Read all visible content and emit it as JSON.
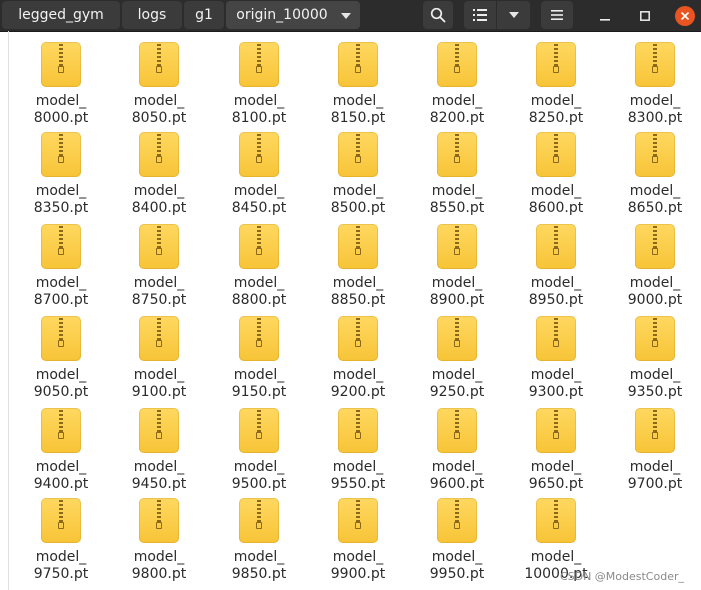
{
  "breadcrumbs": [
    {
      "label": "legged_gym"
    },
    {
      "label": "logs"
    },
    {
      "label": "g1"
    },
    {
      "label": "origin_10000"
    }
  ],
  "icons": {
    "search": "search-icon",
    "list_view": "list-view-icon",
    "view_options": "chevron-down-icon",
    "menu": "hamburger-menu-icon",
    "minimize": "minimize-icon",
    "maximize": "maximize-icon",
    "close": "close-icon",
    "file": "archive-file-icon"
  },
  "colors": {
    "header_bg": "#2c2c2c",
    "close_button": "#e95420",
    "archive_icon": "#f7c437"
  },
  "files": [
    "model_\n8000.pt",
    "model_\n8050.pt",
    "model_\n8100.pt",
    "model_\n8150.pt",
    "model_\n8200.pt",
    "model_\n8250.pt",
    "model_\n8300.pt",
    "model_\n8350.pt",
    "model_\n8400.pt",
    "model_\n8450.pt",
    "model_\n8500.pt",
    "model_\n8550.pt",
    "model_\n8600.pt",
    "model_\n8650.pt",
    "model_\n8700.pt",
    "model_\n8750.pt",
    "model_\n8800.pt",
    "model_\n8850.pt",
    "model_\n8900.pt",
    "model_\n8950.pt",
    "model_\n9000.pt",
    "model_\n9050.pt",
    "model_\n9100.pt",
    "model_\n9150.pt",
    "model_\n9200.pt",
    "model_\n9250.pt",
    "model_\n9300.pt",
    "model_\n9350.pt",
    "model_\n9400.pt",
    "model_\n9450.pt",
    "model_\n9500.pt",
    "model_\n9550.pt",
    "model_\n9600.pt",
    "model_\n9650.pt",
    "model_\n9700.pt",
    "model_\n9750.pt",
    "model_\n9800.pt",
    "model_\n9850.pt",
    "model_\n9900.pt",
    "model_\n9950.pt",
    "model_\n10000.pt"
  ],
  "watermark": "CSDN @ModestCoder_"
}
